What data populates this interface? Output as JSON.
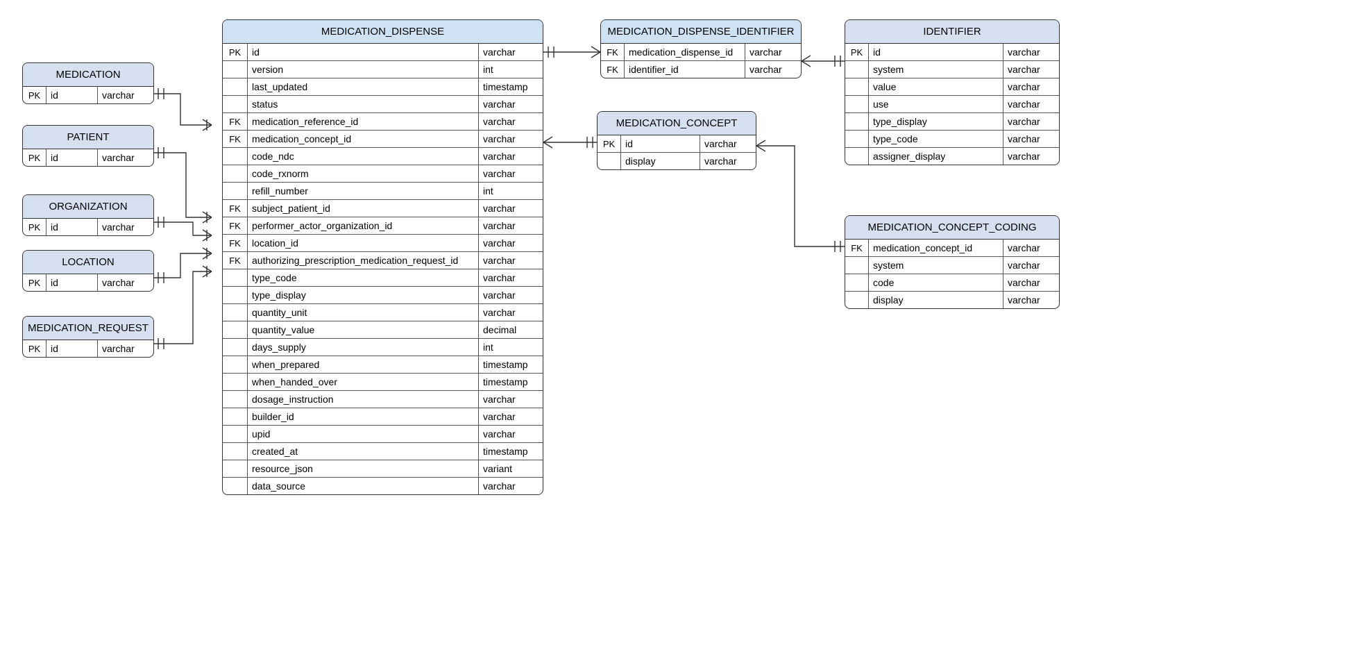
{
  "entities": {
    "medication": {
      "title": "MEDICATION",
      "rows": [
        {
          "key": "PK",
          "name": "id",
          "type": "varchar"
        }
      ]
    },
    "patient": {
      "title": "PATIENT",
      "rows": [
        {
          "key": "PK",
          "name": "id",
          "type": "varchar"
        }
      ]
    },
    "organization": {
      "title": "ORGANIZATION",
      "rows": [
        {
          "key": "PK",
          "name": "id",
          "type": "varchar"
        }
      ]
    },
    "location": {
      "title": "LOCATION",
      "rows": [
        {
          "key": "PK",
          "name": "id",
          "type": "varchar"
        }
      ]
    },
    "medication_request": {
      "title": "MEDICATION_REQUEST",
      "rows": [
        {
          "key": "PK",
          "name": "id",
          "type": "varchar"
        }
      ]
    },
    "medication_dispense": {
      "title": "MEDICATION_DISPENSE",
      "rows": [
        {
          "key": "PK",
          "name": "id",
          "type": "varchar"
        },
        {
          "key": "",
          "name": "version",
          "type": "int"
        },
        {
          "key": "",
          "name": "last_updated",
          "type": "timestamp"
        },
        {
          "key": "",
          "name": "status",
          "type": "varchar"
        },
        {
          "key": "FK",
          "name": "medication_reference_id",
          "type": "varchar"
        },
        {
          "key": "FK",
          "name": "medication_concept_id",
          "type": "varchar"
        },
        {
          "key": "",
          "name": "code_ndc",
          "type": "varchar"
        },
        {
          "key": "",
          "name": "code_rxnorm",
          "type": "varchar"
        },
        {
          "key": "",
          "name": "refill_number",
          "type": "int"
        },
        {
          "key": "FK",
          "name": "subject_patient_id",
          "type": "varchar"
        },
        {
          "key": "FK",
          "name": "performer_actor_organization_id",
          "type": "varchar"
        },
        {
          "key": "FK",
          "name": "location_id",
          "type": "varchar"
        },
        {
          "key": "FK",
          "name": "authorizing_prescription_medication_request_id",
          "type": "varchar"
        },
        {
          "key": "",
          "name": "type_code",
          "type": "varchar"
        },
        {
          "key": "",
          "name": "type_display",
          "type": "varchar"
        },
        {
          "key": "",
          "name": "quantity_unit",
          "type": "varchar"
        },
        {
          "key": "",
          "name": "quantity_value",
          "type": "decimal"
        },
        {
          "key": "",
          "name": "days_supply",
          "type": "int"
        },
        {
          "key": "",
          "name": "when_prepared",
          "type": "timestamp"
        },
        {
          "key": "",
          "name": "when_handed_over",
          "type": "timestamp"
        },
        {
          "key": "",
          "name": "dosage_instruction",
          "type": "varchar"
        },
        {
          "key": "",
          "name": "builder_id",
          "type": "varchar"
        },
        {
          "key": "",
          "name": "upid",
          "type": "varchar"
        },
        {
          "key": "",
          "name": "created_at",
          "type": "timestamp"
        },
        {
          "key": "",
          "name": "resource_json",
          "type": "variant"
        },
        {
          "key": "",
          "name": "data_source",
          "type": "varchar"
        }
      ]
    },
    "medication_dispense_identifier": {
      "title": "MEDICATION_DISPENSE_IDENTIFIER",
      "rows": [
        {
          "key": "FK",
          "name": "medication_dispense_id",
          "type": "varchar"
        },
        {
          "key": "FK",
          "name": "identifier_id",
          "type": "varchar"
        }
      ]
    },
    "medication_concept": {
      "title": "MEDICATION_CONCEPT",
      "rows": [
        {
          "key": "PK",
          "name": "id",
          "type": "varchar"
        },
        {
          "key": "",
          "name": "display",
          "type": "varchar"
        }
      ]
    },
    "identifier": {
      "title": "IDENTIFIER",
      "rows": [
        {
          "key": "PK",
          "name": "id",
          "type": "varchar"
        },
        {
          "key": "",
          "name": "system",
          "type": "varchar"
        },
        {
          "key": "",
          "name": "value",
          "type": "varchar"
        },
        {
          "key": "",
          "name": "use",
          "type": "varchar"
        },
        {
          "key": "",
          "name": "type_display",
          "type": "varchar"
        },
        {
          "key": "",
          "name": "type_code",
          "type": "varchar"
        },
        {
          "key": "",
          "name": "assigner_display",
          "type": "varchar"
        }
      ]
    },
    "medication_concept_coding": {
      "title": "MEDICATION_CONCEPT_CODING",
      "rows": [
        {
          "key": "FK",
          "name": "medication_concept_id",
          "type": "varchar"
        },
        {
          "key": "",
          "name": "system",
          "type": "varchar"
        },
        {
          "key": "",
          "name": "code",
          "type": "varchar"
        },
        {
          "key": "",
          "name": "display",
          "type": "varchar"
        }
      ]
    }
  }
}
